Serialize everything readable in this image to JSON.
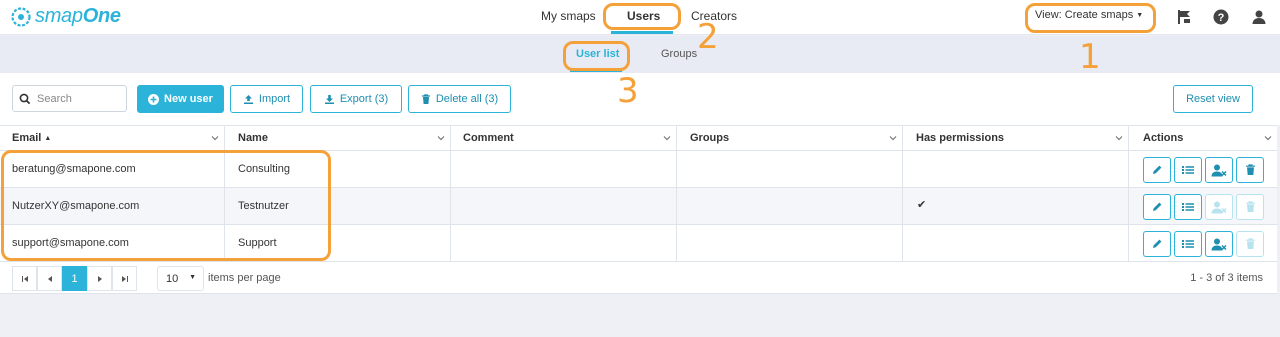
{
  "app": {
    "logo_text_light": "smap",
    "logo_text_bold": "One"
  },
  "nav": {
    "tabs": [
      {
        "label": "My smaps"
      },
      {
        "label": "Users"
      },
      {
        "label": "Creators"
      }
    ],
    "view_label": "View: ",
    "view_value": "Create smaps"
  },
  "subnav": {
    "tabs": [
      {
        "label": "User list"
      },
      {
        "label": "Groups"
      }
    ]
  },
  "toolbar": {
    "search_placeholder": "Search",
    "new_user": "New user",
    "import": "Import",
    "export": "Export (3)",
    "delete_all": "Delete all (3)",
    "reset_view": "Reset view"
  },
  "grid": {
    "columns": [
      "Email",
      "Name",
      "Comment",
      "Groups",
      "Has permissions",
      "Actions"
    ],
    "sort_indicator": "▲",
    "rows": [
      {
        "email": "beratung@smapone.com",
        "name": "Consulting",
        "comment": "",
        "groups": "",
        "has_permissions": "",
        "remove_enabled": true,
        "delete_enabled": true
      },
      {
        "email": "NutzerXY@smapone.com",
        "name": "Testnutzer",
        "comment": "",
        "groups": "",
        "has_permissions": "✔",
        "remove_enabled": false,
        "delete_enabled": false
      },
      {
        "email": "support@smapone.com",
        "name": "Support",
        "comment": "",
        "groups": "",
        "has_permissions": "",
        "remove_enabled": true,
        "delete_enabled": false
      }
    ]
  },
  "pagination": {
    "current_page": "1",
    "per_page": "10",
    "per_page_label": "items per page",
    "range": "1 - 3 of 3 items"
  },
  "annotations": {
    "n1": "1",
    "n2": "2",
    "n3": "3"
  },
  "colors": {
    "accent": "#2bb3d9",
    "highlight": "#f4a13a"
  }
}
